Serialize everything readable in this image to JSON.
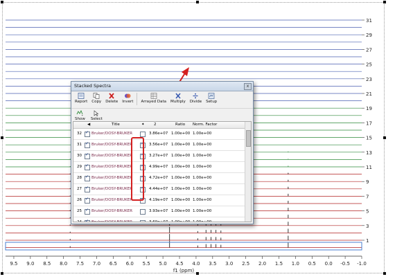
{
  "plot": {
    "axis_title": "f1 (ppm)",
    "x_ticks": [
      "9.5",
      "9.0",
      "8.5",
      "8.0",
      "7.5",
      "7.0",
      "6.5",
      "6.0",
      "5.5",
      "5.0",
      "4.5",
      "4.0",
      "3.5",
      "3.0",
      "2.5",
      "2.0",
      "1.5",
      "1.0",
      "0.5",
      "0.0",
      "-0.5",
      "-1.0"
    ],
    "trace_labels": [
      "31",
      "29",
      "27",
      "25",
      "23",
      "21",
      "19",
      "17",
      "15",
      "13",
      "11",
      "9",
      "7",
      "5",
      "3",
      "1"
    ],
    "colors": {
      "blue": "#4a5fb0",
      "green": "#2e8a3a",
      "red": "#b02020",
      "selection": "#4a7fd0"
    }
  },
  "dialog": {
    "title": "Stacked Spectra",
    "close_glyph": "x",
    "toolbar": {
      "report": "Report",
      "copy": "Copy",
      "delete": "Delete",
      "invert": "Invert",
      "arrayed_data": "Arrayed Data",
      "multiply": "Multiply",
      "divide": "Divide",
      "setup": "Setup",
      "show": "Show",
      "select": "Select"
    },
    "columns": {
      "title": "Title",
      "col2": "2",
      "ratio": "Ratio",
      "norm": "Norm. Factor"
    },
    "rows": [
      {
        "num": "32",
        "title": "Bruker/DOSY-BRUKER",
        "value": "3.86e+07",
        "ratio": "1.00e+00",
        "norm": "1.00e+00",
        "sel": false
      },
      {
        "num": "31",
        "title": "Bruker/DOSY-BRUKER",
        "value": "3.56e+07",
        "ratio": "1.00e+00",
        "norm": "1.00e+00",
        "sel": true
      },
      {
        "num": "30",
        "title": "Bruker/DOSY-BRUKER",
        "value": "3.27e+07",
        "ratio": "1.00e+00",
        "norm": "1.00e+00",
        "sel": true
      },
      {
        "num": "29",
        "title": "Bruker/DOSY-BRUKER",
        "value": "4.99e+07",
        "ratio": "1.00e+00",
        "norm": "1.00e+00",
        "sel": true
      },
      {
        "num": "28",
        "title": "Bruker/DOSY-BRUKER",
        "value": "4.72e+07",
        "ratio": "1.00e+00",
        "norm": "1.00e+00",
        "sel": true
      },
      {
        "num": "27",
        "title": "Bruker/DOSY-BRUKER",
        "value": "4.44e+07",
        "ratio": "1.00e+00",
        "norm": "1.00e+00",
        "sel": true
      },
      {
        "num": "26",
        "title": "Bruker/DOSY-BRUKER",
        "value": "4.19e+07",
        "ratio": "1.00e+00",
        "norm": "1.00e+00",
        "sel": true
      },
      {
        "num": "25",
        "title": "Bruker/DOSY-BRUKER",
        "value": "3.93e+07",
        "ratio": "1.00e+00",
        "norm": "1.00e+00",
        "sel": false
      },
      {
        "num": "24",
        "title": "Bruker/DOSY-BRUKER",
        "value": "3.69e+07",
        "ratio": "1.00e+00",
        "norm": "1.00e+00",
        "sel": false
      }
    ]
  }
}
